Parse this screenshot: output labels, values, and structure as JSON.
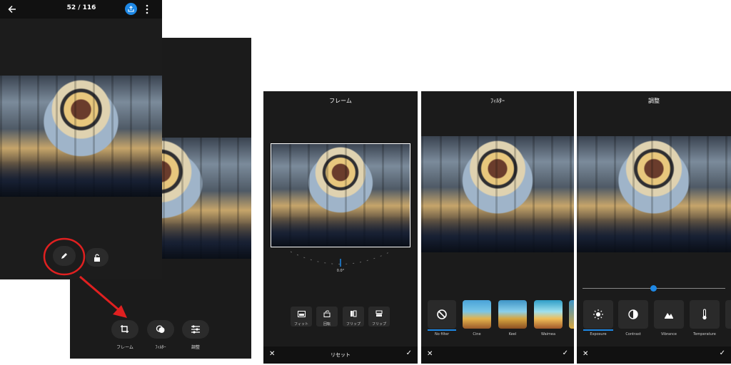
{
  "viewer": {
    "counter": "52 / 116",
    "icons": {
      "back": "back-arrow-icon",
      "share": "share-icon",
      "more": "more-vertical-icon",
      "edit": "pencil-icon",
      "lock": "lock-icon"
    },
    "accent_color": "#1e88e5",
    "highlight_color": "#e02020"
  },
  "edit_menu": {
    "items": [
      {
        "label": "フレーム",
        "icon": "crop-icon"
      },
      {
        "label": "ﾌｨﾙﾀｰ",
        "icon": "filter-icon"
      },
      {
        "label": "調整",
        "icon": "sliders-icon"
      }
    ]
  },
  "frame_screen": {
    "title": "フレーム",
    "angle": "0.0°",
    "tools": [
      {
        "label": "フィット",
        "icon": "fit-icon"
      },
      {
        "label": "回転",
        "icon": "rotate-icon"
      },
      {
        "label": "フリップ",
        "icon": "flip-horizontal-icon"
      },
      {
        "label": "フリップ",
        "icon": "flip-vertical-icon"
      }
    ],
    "reset_label": "リセット"
  },
  "filter_screen": {
    "title": "ﾌｨﾙﾀｰ",
    "filters": [
      "No filter",
      "Cine",
      "Keel",
      "Waimea"
    ],
    "selected": "No filter"
  },
  "adjust_screen": {
    "title": "調整",
    "slider_value": 0.5,
    "items": [
      {
        "label": "Exposure",
        "icon": "sun-icon"
      },
      {
        "label": "Contrast",
        "icon": "contrast-icon"
      },
      {
        "label": "Vibrance",
        "icon": "vibrance-icon"
      },
      {
        "label": "Temperature",
        "icon": "thermometer-icon"
      }
    ],
    "selected": "Exposure"
  }
}
